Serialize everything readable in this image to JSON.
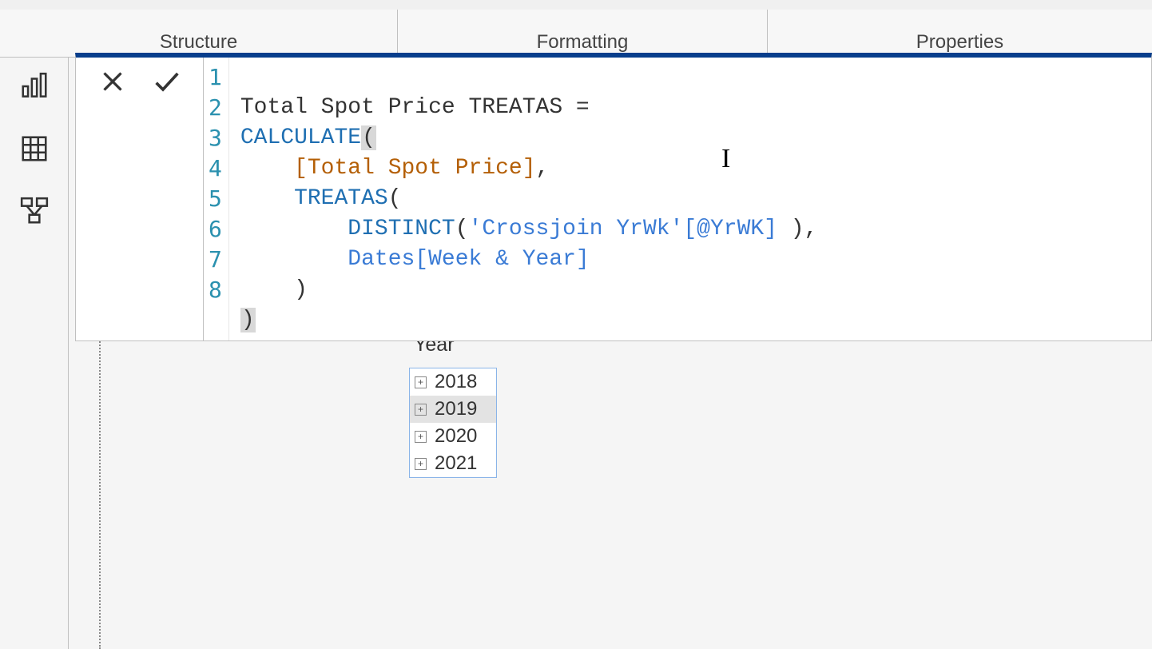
{
  "ribbon": {
    "structure": "Structure",
    "formatting": "Formatting",
    "properties": "Properties"
  },
  "formula": {
    "lines": {
      "l1": "Total Spot Price TREATAS =",
      "l2a": "CALCULATE",
      "l2b": "(",
      "l3a": "    ",
      "l3b": "[Total Spot Price]",
      "l3c": ",",
      "l4a": "    ",
      "l4b": "TREATAS",
      "l4c": "(",
      "l5a": "        ",
      "l5b": "DISTINCT",
      "l5c": "(",
      "l5d": "'Crossjoin YrWk'[@YrWK]",
      "l5e": " ),",
      "l6a": "        ",
      "l6b": "Dates[Week & Year]",
      "l7": "    )",
      "l8": ")"
    },
    "line_numbers": [
      "1",
      "2",
      "3",
      "4",
      "5",
      "6",
      "7",
      "8"
    ]
  },
  "slicer": {
    "title": "Year",
    "items": [
      {
        "label": "2018",
        "selected": false
      },
      {
        "label": "2019",
        "selected": true
      },
      {
        "label": "2020",
        "selected": false
      },
      {
        "label": "2021",
        "selected": false
      }
    ]
  },
  "icons": {
    "plus": "+"
  }
}
